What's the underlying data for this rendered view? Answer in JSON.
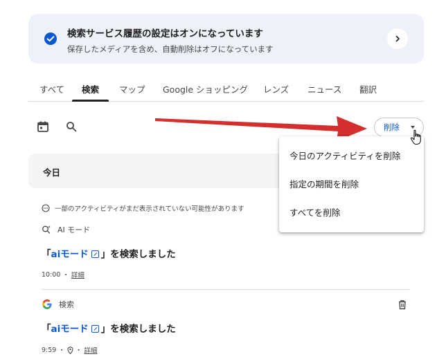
{
  "banner": {
    "title": "検索サービス履歴の設定はオンになっています",
    "subtitle": "保存したメディアを含め、自動削除はオフになっています",
    "icon": "check-circle-icon",
    "action_icon": "chevron-right-icon"
  },
  "tabs": [
    {
      "label": "すべて",
      "active": false
    },
    {
      "label": "検索",
      "active": true
    },
    {
      "label": "マップ",
      "active": false
    },
    {
      "label": "Google ショッピング",
      "active": false
    },
    {
      "label": "レンズ",
      "active": false
    },
    {
      "label": "ニュース",
      "active": false
    },
    {
      "label": "翻訳",
      "active": false
    }
  ],
  "toolbar": {
    "calendar_icon": "calendar-icon",
    "search_icon": "search-icon",
    "delete_label": "削除"
  },
  "delete_menu": {
    "items": [
      {
        "label": "今日のアクティビティを削除"
      },
      {
        "label": "指定の期間を削除"
      },
      {
        "label": "すべてを削除"
      }
    ]
  },
  "section": {
    "label": "今日"
  },
  "notice": {
    "text": "一部のアクティビティがまだ表示されていない可能性があります"
  },
  "entries": [
    {
      "source": "AI モード",
      "source_icon": "ai-mode-icon",
      "title_prefix": "「",
      "query": "aiモード",
      "title_suffix": "」を検索しました",
      "time": "10:00",
      "separator": "・",
      "details": "詳細"
    },
    {
      "source": "検索",
      "source_icon": "google-g-icon",
      "title_prefix": "「",
      "query": "aiモード",
      "title_suffix": "」を検索しました",
      "time": "9:59",
      "separator": "・",
      "details": "詳細"
    }
  ],
  "colors": {
    "accent": "#0b57d0",
    "banner_bg": "#eef2f8",
    "arrow": "#d32f2f"
  }
}
